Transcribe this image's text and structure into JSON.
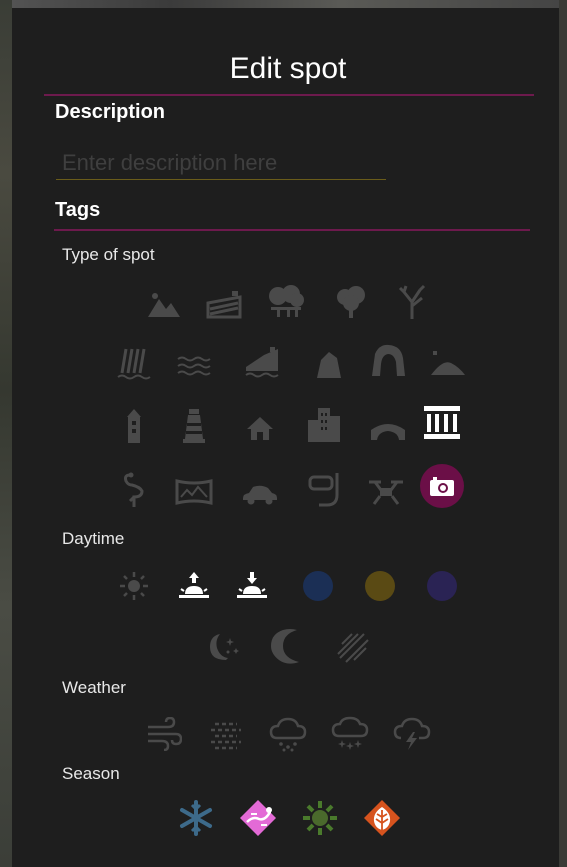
{
  "dialog": {
    "title": "Edit spot",
    "description_label": "Description",
    "description_value": "",
    "description_placeholder": "Enter description here",
    "tags_label": "Tags"
  },
  "groups": {
    "type_of_spot": "Type of spot",
    "daytime": "Daytime",
    "weather": "Weather",
    "season": "Season"
  },
  "type_of_spot_icons": [
    [
      "mountains-icon",
      "fields-icon",
      "forest-icon",
      "tree-icon",
      "bare-tree-icon"
    ],
    [
      "waterfall-icon",
      "water-icon",
      "cliff-icon",
      "rock-icon",
      "arch-icon",
      "dune-icon"
    ],
    [
      "tower-icon",
      "lighthouse-icon",
      "house-icon",
      "city-icon",
      "bridge-icon",
      "museum-icon"
    ],
    [
      "flamingo-icon",
      "panorama-icon",
      "car-icon",
      "snorkel-icon",
      "drone-icon",
      "camera-icon"
    ]
  ],
  "selected_type": "camera-icon",
  "daytime_icons": [
    "sun-icon",
    "sunrise-icon",
    "sunset-icon",
    "blue-hour-icon",
    "golden-hour-icon",
    "twilight-icon",
    "night-stars-icon",
    "moon-icon",
    "meteor-icon"
  ],
  "weather_icons": [
    "wind-icon",
    "fog-icon",
    "rain-icon",
    "snow-icon",
    "storm-icon"
  ],
  "season_icons": [
    "winter-icon",
    "spring-icon",
    "summer-icon",
    "autumn-icon"
  ],
  "colors": {
    "accent": "#6b0f47",
    "rule": "#6d1a4d",
    "inactive_icon": "#4a4a4a",
    "active_icon": "#ffffff",
    "blue_hour": "#1b2f55",
    "golden_hour": "#5a4a14",
    "twilight": "#2a2354",
    "winter": "#3d6a8a",
    "spring": "#e36ad6",
    "summer": "#4a7a2c",
    "autumn": "#d6531e"
  }
}
